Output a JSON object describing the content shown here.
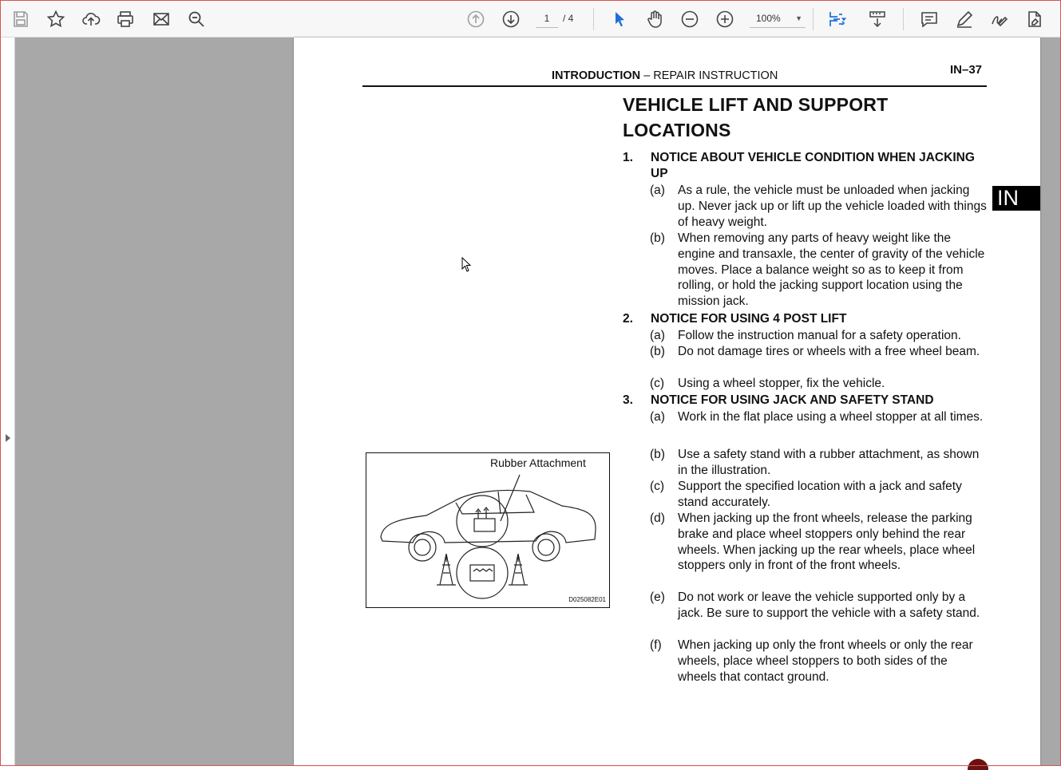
{
  "toolbar": {
    "page_current": "1",
    "page_total": "/ 4",
    "zoom": "100%",
    "icons": [
      "save-icon",
      "bookmark-star-icon",
      "upload-cloud-icon",
      "print-icon",
      "email-icon",
      "search-icon",
      "page-up-icon",
      "page-down-icon",
      "select-cursor-icon",
      "hand-pan-icon",
      "zoom-out-icon",
      "zoom-in-icon",
      "fit-page-icon",
      "scroll-mode-icon",
      "comment-icon",
      "draw-icon",
      "sign-icon",
      "more-tools-icon"
    ]
  },
  "document": {
    "header_bold": "INTRODUCTION",
    "header_rest": " –  REPAIR INSTRUCTION",
    "page_number": "IN–37",
    "tab_label": "IN",
    "title": "VEHICLE LIFT AND SUPPORT LOCATIONS",
    "sections": [
      {
        "num": "1.",
        "heading": "NOTICE ABOUT VEHICLE CONDITION WHEN JACKING UP",
        "items": [
          {
            "label": "(a)",
            "text": "As a rule, the vehicle must be unloaded when jacking up. Never jack up or lift up the vehicle loaded with things of heavy weight."
          },
          {
            "label": "(b)",
            "text": "When removing any parts of heavy weight like the engine and transaxle, the center of gravity of the vehicle moves. Place a balance weight so as to keep it from rolling, or hold the jacking support location using the mission jack."
          }
        ]
      },
      {
        "num": "2.",
        "heading": "NOTICE FOR USING 4 POST LIFT",
        "items": [
          {
            "label": "(a)",
            "text": "Follow the instruction manual for a safety operation."
          },
          {
            "label": "(b)",
            "text": "Do not damage tires or wheels with a free wheel beam."
          },
          {
            "label": "(c)",
            "text": "Using a wheel stopper, fix the vehicle."
          }
        ]
      },
      {
        "num": "3.",
        "heading": "NOTICE FOR USING JACK AND SAFETY STAND",
        "items": [
          {
            "label": "(a)",
            "text": "Work in the flat place using a wheel stopper at all times."
          },
          {
            "label": "(b)",
            "text": "Use a safety stand with a rubber attachment, as shown in the illustration."
          },
          {
            "label": "(c)",
            "text": "Support the specified location with a jack and safety stand accurately."
          },
          {
            "label": "(d)",
            "text": "When jacking up the front wheels, release the parking brake and place wheel stoppers only behind the rear wheels. When jacking up the rear wheels, place wheel stoppers only in front of the front wheels."
          },
          {
            "label": "(e)",
            "text": "Do not work or leave the vehicle supported only by a jack. Be sure to support the vehicle with a safety stand."
          },
          {
            "label": "(f)",
            "text": "When jacking up only the front wheels or only the rear wheels, place wheel stoppers to both sides of the wheels that contact ground."
          }
        ]
      }
    ],
    "figure": {
      "callout": "Rubber Attachment",
      "code": "D025082E01"
    }
  }
}
